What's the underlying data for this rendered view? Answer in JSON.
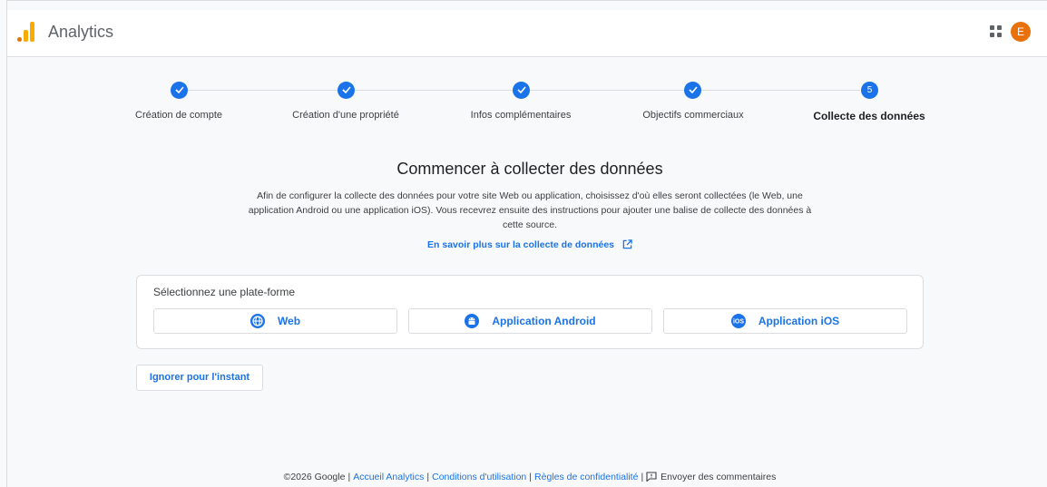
{
  "header": {
    "app_title": "Analytics",
    "avatar_letter": "E",
    "apps_icon": "grid-apps-icon"
  },
  "stepper": {
    "steps": [
      {
        "label": "Création de compte",
        "status": "done"
      },
      {
        "label": "Création d'une propriété",
        "status": "done"
      },
      {
        "label": "Infos complémentaires",
        "status": "done"
      },
      {
        "label": "Objectifs commerciaux",
        "status": "done"
      },
      {
        "label": "Collecte des données",
        "status": "current",
        "number": "5"
      }
    ]
  },
  "main": {
    "heading": "Commencer à collecter des données",
    "description": "Afin de configurer la collecte des données pour votre site Web ou application, choisissez d'où elles seront collectées (le Web, une application Android ou une application iOS). Vous recevrez ensuite des instructions pour ajouter une balise de collecte des données à cette source.",
    "learn_more": "En savoir plus sur la collecte de données",
    "platform": {
      "label": "Sélectionnez une plate-forme",
      "options": [
        {
          "label": "Web",
          "icon": "globe-icon"
        },
        {
          "label": "Application Android",
          "icon": "android-icon"
        },
        {
          "label": "Application iOS",
          "icon": "ios-icon"
        }
      ]
    },
    "skip_button": "Ignorer pour l'instant"
  },
  "footer": {
    "copyright": "©2026 Google",
    "links": [
      "Accueil Analytics",
      "Conditions d'utilisation",
      "Règles de confidentialité"
    ],
    "feedback": "Envoyer des commentaires"
  },
  "colors": {
    "accent": "#1a73e8",
    "avatar": "#e8710a",
    "logo_orange": "#f9ab00"
  }
}
